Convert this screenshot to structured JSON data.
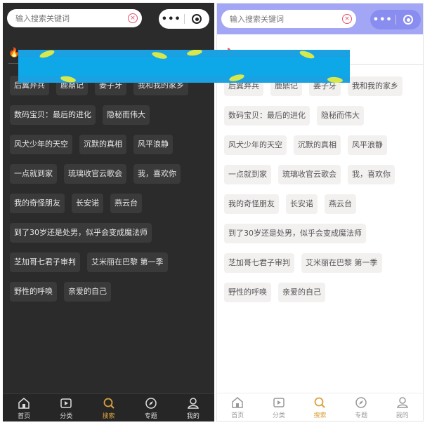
{
  "search": {
    "placeholder": "输入搜索关键词"
  },
  "capsule": {
    "more": "•••"
  },
  "tags": [
    [
      "后翼弃兵",
      "鹿鼎记",
      "姜子牙",
      "我和我的家乡"
    ],
    [
      "数码宝贝：最后的进化",
      "隐秘而伟大"
    ],
    [
      "风犬少年的天空",
      "沉默的真相",
      "风平浪静"
    ],
    [
      "一点就到家",
      "琉璃收官云歌会",
      "我，喜欢你"
    ],
    [
      "我的奇怪朋友",
      "长安诺",
      "燕云台"
    ],
    [
      "到了30岁还是处男，似乎会变成魔法师"
    ],
    [
      "芝加哥七君子审判",
      "艾米丽在巴黎 第一季"
    ],
    [
      "野性的呼唤",
      "亲爱的自己"
    ]
  ],
  "tabbar": [
    {
      "label": "首页",
      "icon": "home-icon"
    },
    {
      "label": "分类",
      "icon": "video-icon"
    },
    {
      "label": "搜索",
      "icon": "search-icon",
      "active": true
    },
    {
      "label": "专题",
      "icon": "compass-icon"
    },
    {
      "label": "我的",
      "icon": "user-icon"
    }
  ],
  "colors": {
    "dark_bg": "#2b2b2b",
    "light_header": "#a2a6f5",
    "active_tab": "#d8a13c",
    "clear_icon": "#e8516a",
    "redaction": "#1ba0e1"
  }
}
